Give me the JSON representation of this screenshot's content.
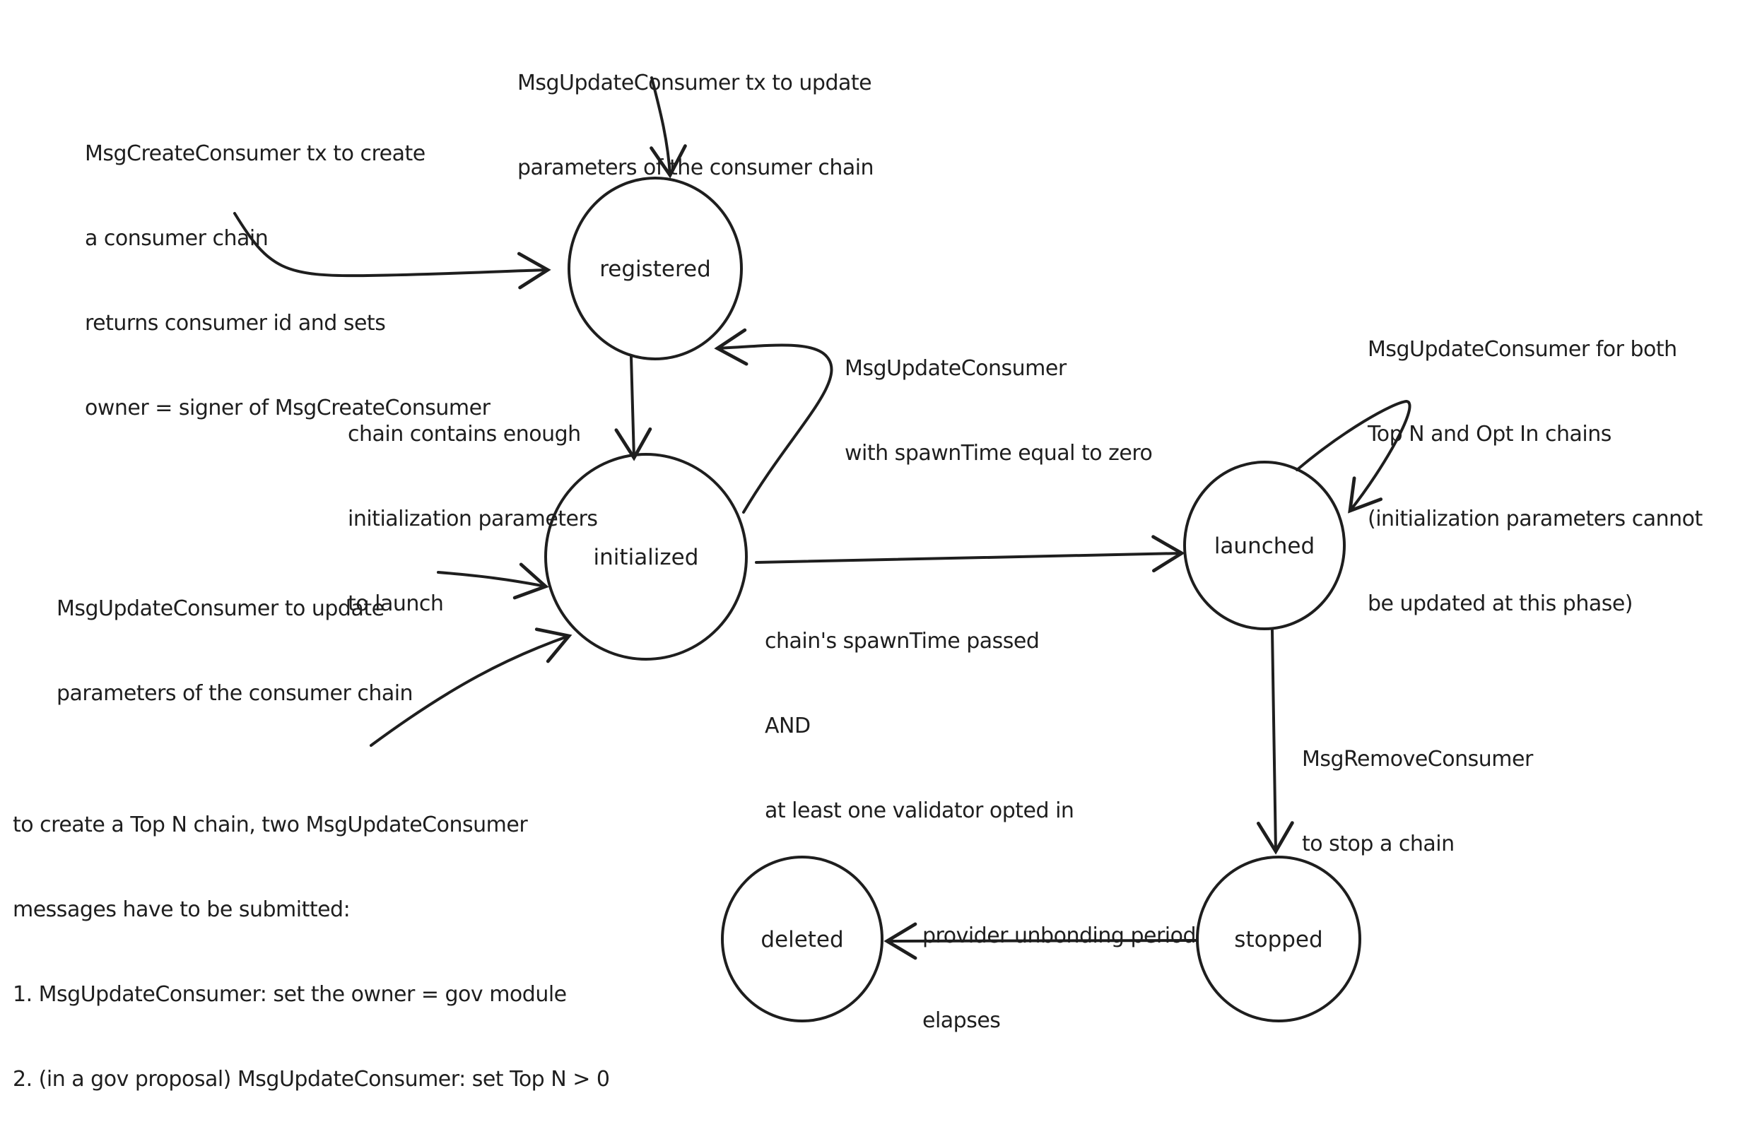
{
  "title": "Consumer chain lifecycle state diagram",
  "colors": {
    "stroke": "#1e1e1e",
    "background": "#ffffff"
  },
  "states": {
    "registered": "registered",
    "initialized": "initialized",
    "launched": "launched",
    "stopped": "stopped",
    "deleted": "deleted"
  },
  "annotations": {
    "update_registered": [
      "MsgUpdateConsumer tx to update",
      "parameters of the consumer chain"
    ],
    "create_consumer": [
      "MsgCreateConsumer tx to create",
      "a consumer chain",
      "returns consumer id and sets",
      "owner = signer of MsgCreateConsumer"
    ],
    "spawn_zero": [
      "MsgUpdateConsumer",
      "with spawnTime equal to zero"
    ],
    "enough_params": [
      "chain contains enough",
      "initialization parameters",
      "to launch"
    ],
    "update_initialized": [
      "MsgUpdateConsumer to update",
      "parameters of the consumer chain"
    ],
    "spawn_passed": [
      "chain's spawnTime passed",
      "AND",
      "at least one validator opted in"
    ],
    "update_launched": [
      "MsgUpdateConsumer for both",
      "Top N and Opt In chains",
      "(initialization parameters cannot",
      "be updated at this phase)"
    ],
    "remove_consumer": [
      "MsgRemoveConsumer",
      "to stop a chain"
    ],
    "top_n_note": [
      "to create a Top N chain, two MsgUpdateConsumer",
      "messages have to be submitted:",
      "1. MsgUpdateConsumer: set the owner = gov module",
      "2. (in a gov proposal) MsgUpdateConsumer: set Top N > 0"
    ],
    "unbonding": [
      "provider unbonding period",
      "elapses"
    ]
  }
}
